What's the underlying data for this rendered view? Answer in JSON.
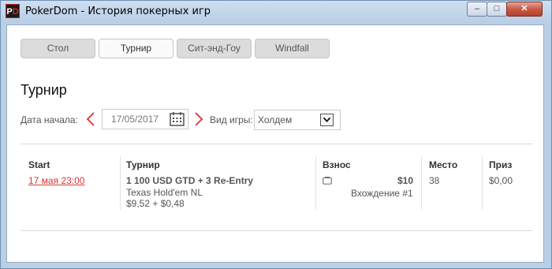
{
  "window": {
    "title": "PokerDom - История покерных игр",
    "icon": "pokerdom-logo-icon",
    "controls": {
      "minimize": "–",
      "maximize": "□",
      "close": "✕"
    }
  },
  "tabs": [
    {
      "label": "Стол",
      "active": false
    },
    {
      "label": "Турнир",
      "active": true
    },
    {
      "label": "Сит-энд-Гоу",
      "active": false
    },
    {
      "label": "Windfall",
      "active": false
    }
  ],
  "heading": "Турнир",
  "filters": {
    "start_date_label": "Дата начала:",
    "start_date_value": "17/05/2017",
    "game_type_label": "Вид игры:",
    "game_type_value": "Холдем"
  },
  "table": {
    "headers": {
      "start": "Start",
      "tournament": "Турнир",
      "buyin": "Взнос",
      "place": "Место",
      "prize": "Приз"
    },
    "rows": [
      {
        "start": "17 мая 23:00",
        "name": "1 100 USD GTD + 3 Re-Entry",
        "game": "Texas Hold'em NL",
        "fee": "$9,52 + $0,48",
        "buyin_amount": "$10",
        "buyin_note": "Вхождение #1",
        "place": "38",
        "prize": "$0,00"
      }
    ]
  },
  "colors": {
    "accent": "#dd3333",
    "tab_active_bg": "#fafafa",
    "tab_bg": "#dcdcdc"
  }
}
